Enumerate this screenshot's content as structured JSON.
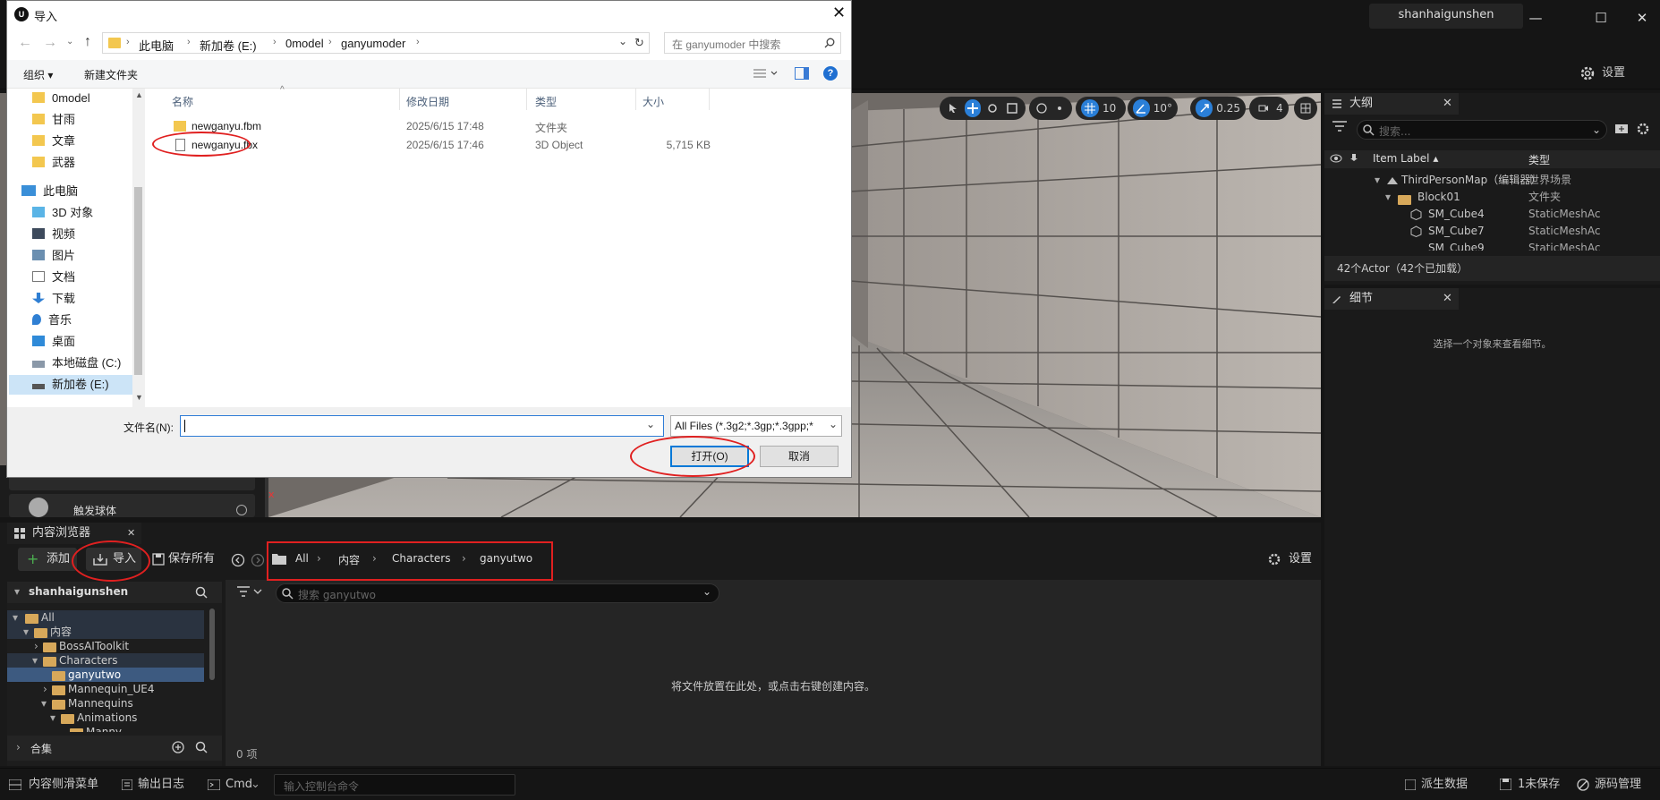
{
  "window": {
    "user_name": "shanhaigunshen",
    "minimize": "—",
    "maximize": "☐",
    "close": "✕"
  },
  "toolbar": {
    "settings_label": "设置"
  },
  "viewport": {
    "grid_snap": "10",
    "angle_snap": "10°",
    "scale_snap": "0.25",
    "camera_speed": "4"
  },
  "outliner": {
    "tab_label": "大纲",
    "search_placeholder": "搜索...",
    "col_item_label": "Item Label ▴",
    "col_type": "类型",
    "rows": [
      {
        "label": "ThirdPersonMap（编辑器）",
        "type": "世界场景"
      },
      {
        "label": "Block01",
        "type": "文件夹"
      },
      {
        "label": "SM_Cube4",
        "type": "StaticMeshAc"
      },
      {
        "label": "SM_Cube7",
        "type": "StaticMeshAc"
      },
      {
        "label": "SM_Cube9",
        "type": "StaticMeshAc"
      }
    ],
    "actor_count": "42个Actor（42个已加载）"
  },
  "details": {
    "tab_label": "细节",
    "empty_message": "选择一个对象来查看细节。"
  },
  "place_panel": {
    "item_label": "触发球体"
  },
  "content_browser": {
    "tab_label": "内容浏览器",
    "add_label": "添加",
    "import_label": "导入",
    "save_all_label": "保存所有",
    "settings_label": "设置",
    "breadcrumb": [
      "All",
      "内容",
      "Characters",
      "ganyutwo"
    ],
    "root_label": "shanhaigunshen",
    "search_placeholder": "搜索 ganyutwo",
    "tree": [
      {
        "label": "All",
        "indent": 0
      },
      {
        "label": "内容",
        "indent": 1
      },
      {
        "label": "BossAIToolkit",
        "indent": 2
      },
      {
        "label": "Characters",
        "indent": 2
      },
      {
        "label": "ganyutwo",
        "indent": 3
      },
      {
        "label": "Mannequin_UE4",
        "indent": 3
      },
      {
        "label": "Mannequins",
        "indent": 3
      },
      {
        "label": "Animations",
        "indent": 4
      },
      {
        "label": "Manny",
        "indent": 5
      }
    ],
    "collections_label": "合集",
    "empty_message": "将文件放置在此处，或点击右键创建内容。",
    "item_count": "0 项"
  },
  "statusbar": {
    "drawer_label": "内容侧滑菜单",
    "output_log_label": "输出日志",
    "cmd_label": "Cmd",
    "console_placeholder": "输入控制台命令",
    "derived_data_label": "派生数据",
    "unsaved_label": "1未保存",
    "source_control_label": "源码管理"
  },
  "dialog": {
    "title": "导入",
    "path": [
      "此电脑",
      "新加卷 (E:)",
      "0model",
      "ganyumoder"
    ],
    "search_placeholder": "在 ganyumoder 中搜索",
    "organize_label": "组织 ▾",
    "new_folder_label": "新建文件夹",
    "nav_items": [
      {
        "label": "0model",
        "icon": "folder"
      },
      {
        "label": "甘雨",
        "icon": "folder"
      },
      {
        "label": "文章",
        "icon": "folder"
      },
      {
        "label": "武器",
        "icon": "folder"
      },
      {
        "label": "此电脑",
        "icon": "pc"
      },
      {
        "label": "3D 对象",
        "icon": "3d"
      },
      {
        "label": "视频",
        "icon": "video"
      },
      {
        "label": "图片",
        "icon": "picture"
      },
      {
        "label": "文档",
        "icon": "document"
      },
      {
        "label": "下载",
        "icon": "download"
      },
      {
        "label": "音乐",
        "icon": "music"
      },
      {
        "label": "桌面",
        "icon": "desktop"
      },
      {
        "label": "本地磁盘 (C:)",
        "icon": "drive"
      },
      {
        "label": "新加卷 (E:)",
        "icon": "drive"
      }
    ],
    "columns": {
      "name": "名称",
      "date": "修改日期",
      "type": "类型",
      "size": "大小"
    },
    "files": [
      {
        "name": "newganyu.fbm",
        "date": "2025/6/15 17:48",
        "type": "文件夹",
        "size": ""
      },
      {
        "name": "newganyu.fbx",
        "date": "2025/6/15 17:46",
        "type": "3D Object",
        "size": "5,715 KB"
      }
    ],
    "filename_label": "文件名(N):",
    "filename_value": "",
    "filter_value": "All Files (*.3g2;*.3gp;*.3gpp;*",
    "open_label": "打开(O)",
    "cancel_label": "取消"
  }
}
